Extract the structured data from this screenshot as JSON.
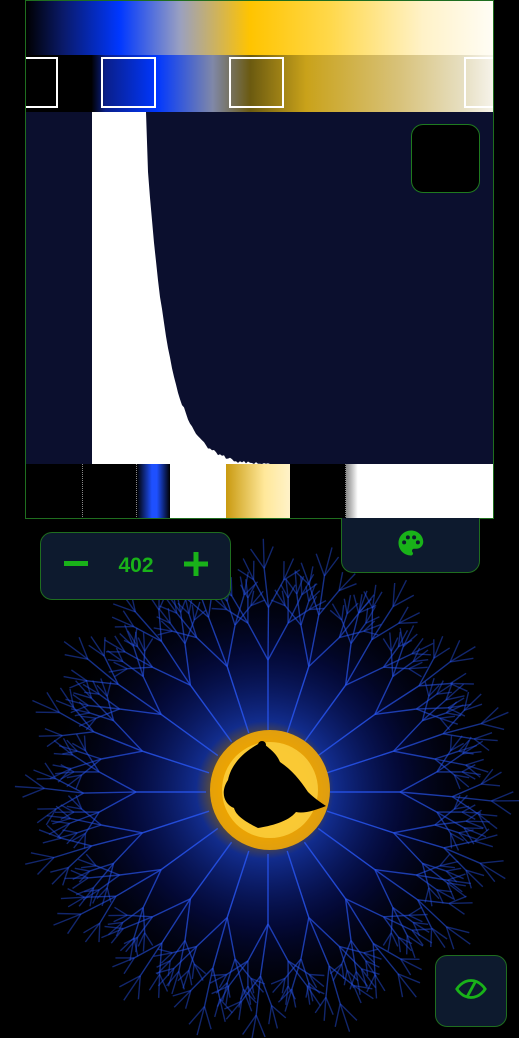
{
  "colors": {
    "accent": "#19b219",
    "border": "#1f6e1f",
    "button_bg": "#0d1a2e",
    "panel_bg": "#0b0f2e",
    "fractal_blue": "#1e50ff",
    "fractal_gold": "#ffc400"
  },
  "gradient_editor": {
    "stops": [
      {
        "color": "#000000"
      },
      {
        "color": "#0037ff"
      },
      {
        "color": "#ffc400"
      },
      {
        "color": "#ffffff"
      }
    ],
    "legend_colors": [
      "#000000",
      "#000000",
      "#1e50ff",
      "#ffffff",
      "#ffd84a",
      "#000000",
      "#ffffff"
    ]
  },
  "iteration_stepper": {
    "value": "402",
    "decrement_icon": "minus-icon",
    "increment_icon": "plus-icon"
  },
  "palette_button": {
    "icon": "palette-icon"
  },
  "visibility_button": {
    "icon": "eye-off-icon"
  }
}
